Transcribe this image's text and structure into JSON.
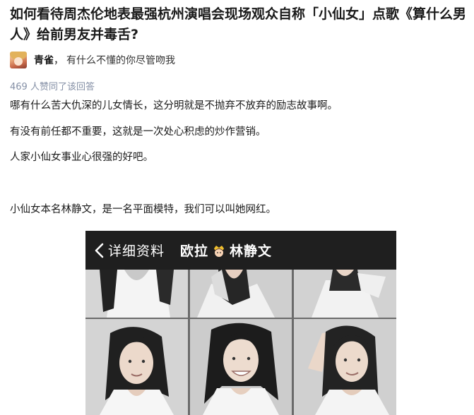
{
  "question": {
    "title": "如何看待周杰伦地表最强杭州演唱会现场观众自称「小仙女」点歌《算什么男人》给前男友并毒舌?"
  },
  "author": {
    "name": "青雀",
    "separator": "，",
    "bio": "有什么不懂的你尽管吻我"
  },
  "answer": {
    "vote_text": "469 人赞同了该回答",
    "paragraphs": [
      "哪有什么苦大仇深的儿女情长，这分明就是不抛弃不放弃的励志故事啊。",
      "有没有前任都不重要，这就是一次处心积虑的炒作营销。",
      "人家小仙女事业心很强的好吧。",
      "小仙女本名林静文，是一名平面模特，我们可以叫她网红。"
    ]
  },
  "photo": {
    "back_label": "详细资料",
    "profile_name_prefix": "欧拉",
    "profile_name_suffix": "林静文",
    "header_icons": [
      "chevron-left-icon",
      "crown-emoji-icon"
    ]
  },
  "colors": {
    "vote_gray": "#8590a6",
    "header_bg": "#1f1f1f"
  }
}
